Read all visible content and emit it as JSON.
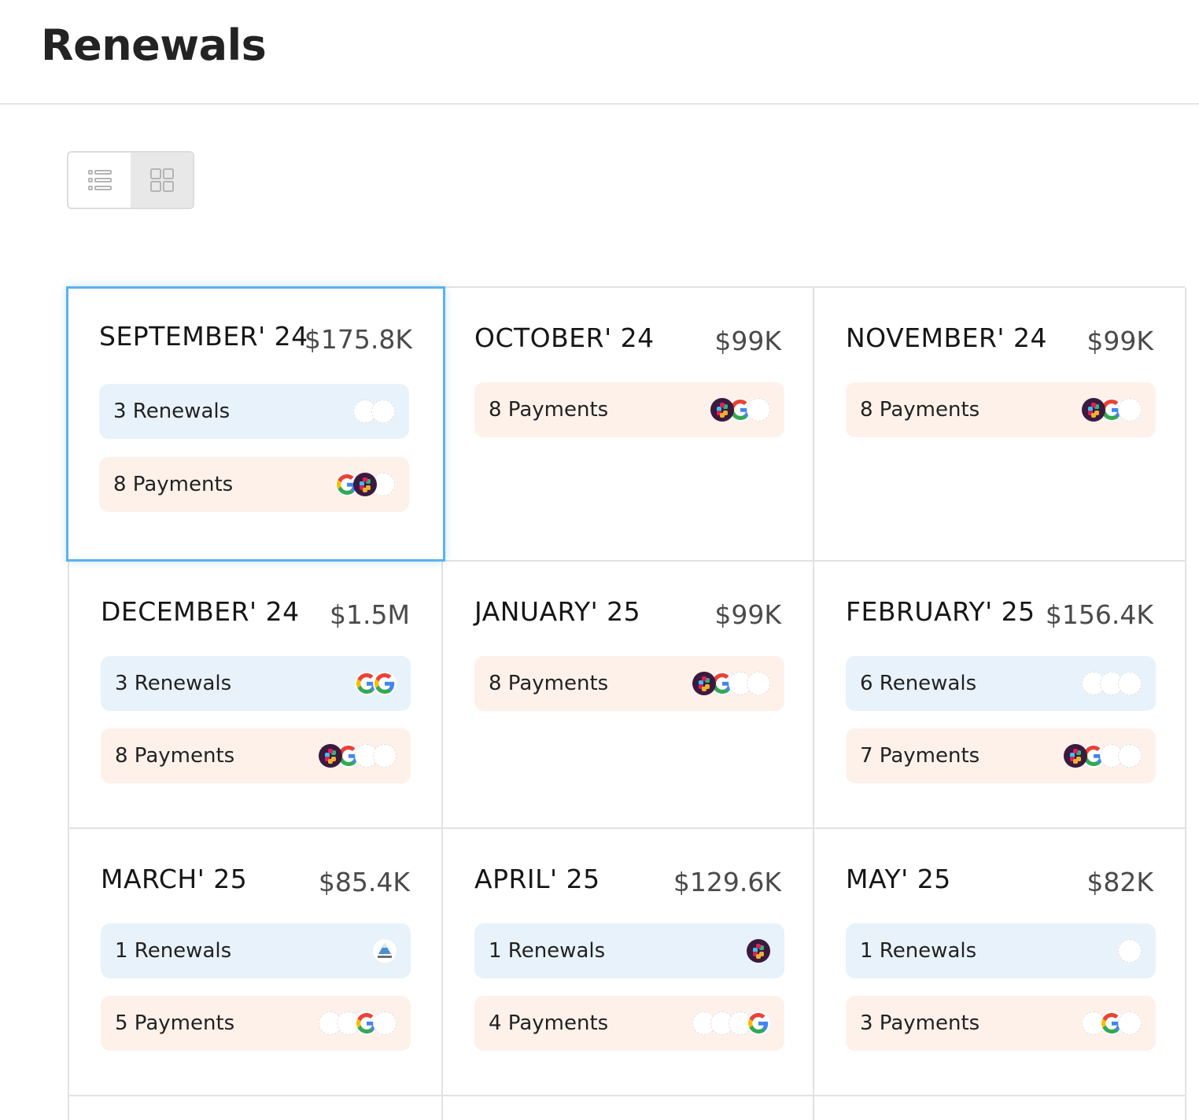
{
  "page": {
    "title": "Renewals"
  },
  "view_toggle": {
    "active": "grid"
  },
  "months": [
    {
      "month": "SEPTEMBER' 24",
      "amount": "$175.8K",
      "selected": true,
      "items": [
        {
          "kind": "renewals",
          "label": "3 Renewals",
          "logos": [
            "blank",
            "blank"
          ]
        },
        {
          "kind": "payments",
          "label": "8 Payments",
          "logos": [
            "google",
            "slack",
            "blank"
          ]
        }
      ]
    },
    {
      "month": "OCTOBER' 24",
      "amount": "$99K",
      "items": [
        {
          "kind": "payments",
          "label": "8 Payments",
          "logos": [
            "slack",
            "google",
            "blank"
          ]
        }
      ]
    },
    {
      "month": "NOVEMBER' 24",
      "amount": "$99K",
      "items": [
        {
          "kind": "payments",
          "label": "8 Payments",
          "logos": [
            "slack",
            "google",
            "blank"
          ]
        }
      ]
    },
    {
      "month": "DECEMBER' 24",
      "amount": "$1.5M",
      "items": [
        {
          "kind": "renewals",
          "label": "3 Renewals",
          "logos": [
            "google",
            "google"
          ]
        },
        {
          "kind": "payments",
          "label": "8 Payments",
          "logos": [
            "slack",
            "google",
            "blank",
            "blank"
          ]
        }
      ]
    },
    {
      "month": "JANUARY' 25",
      "amount": "$99K",
      "items": [
        {
          "kind": "payments",
          "label": "8 Payments",
          "logos": [
            "slack",
            "google",
            "blank",
            "blank"
          ]
        }
      ]
    },
    {
      "month": "FEBRUARY' 25",
      "amount": "$156.4K",
      "items": [
        {
          "kind": "renewals",
          "label": "6 Renewals",
          "logos": [
            "blank",
            "blank",
            "blank"
          ]
        },
        {
          "kind": "payments",
          "label": "7 Payments",
          "logos": [
            "slack",
            "google",
            "blank",
            "blank"
          ]
        }
      ]
    },
    {
      "month": "MARCH' 25",
      "amount": "$85.4K",
      "items": [
        {
          "kind": "renewals",
          "label": "1 Renewals",
          "logos": [
            "mountain"
          ]
        },
        {
          "kind": "payments",
          "label": "5 Payments",
          "logos": [
            "blank",
            "blank",
            "google",
            "blank"
          ]
        }
      ]
    },
    {
      "month": "APRIL' 25",
      "amount": "$129.6K",
      "items": [
        {
          "kind": "renewals",
          "label": "1 Renewals",
          "logos": [
            "slack"
          ]
        },
        {
          "kind": "payments",
          "label": "4 Payments",
          "logos": [
            "blank",
            "blank",
            "blank",
            "google"
          ]
        }
      ]
    },
    {
      "month": "MAY' 25",
      "amount": "$82K",
      "items": [
        {
          "kind": "renewals",
          "label": "1 Renewals",
          "logos": [
            "blank"
          ]
        },
        {
          "kind": "payments",
          "label": "3 Payments",
          "logos": [
            "blank",
            "google",
            "blank"
          ]
        }
      ]
    }
  ]
}
